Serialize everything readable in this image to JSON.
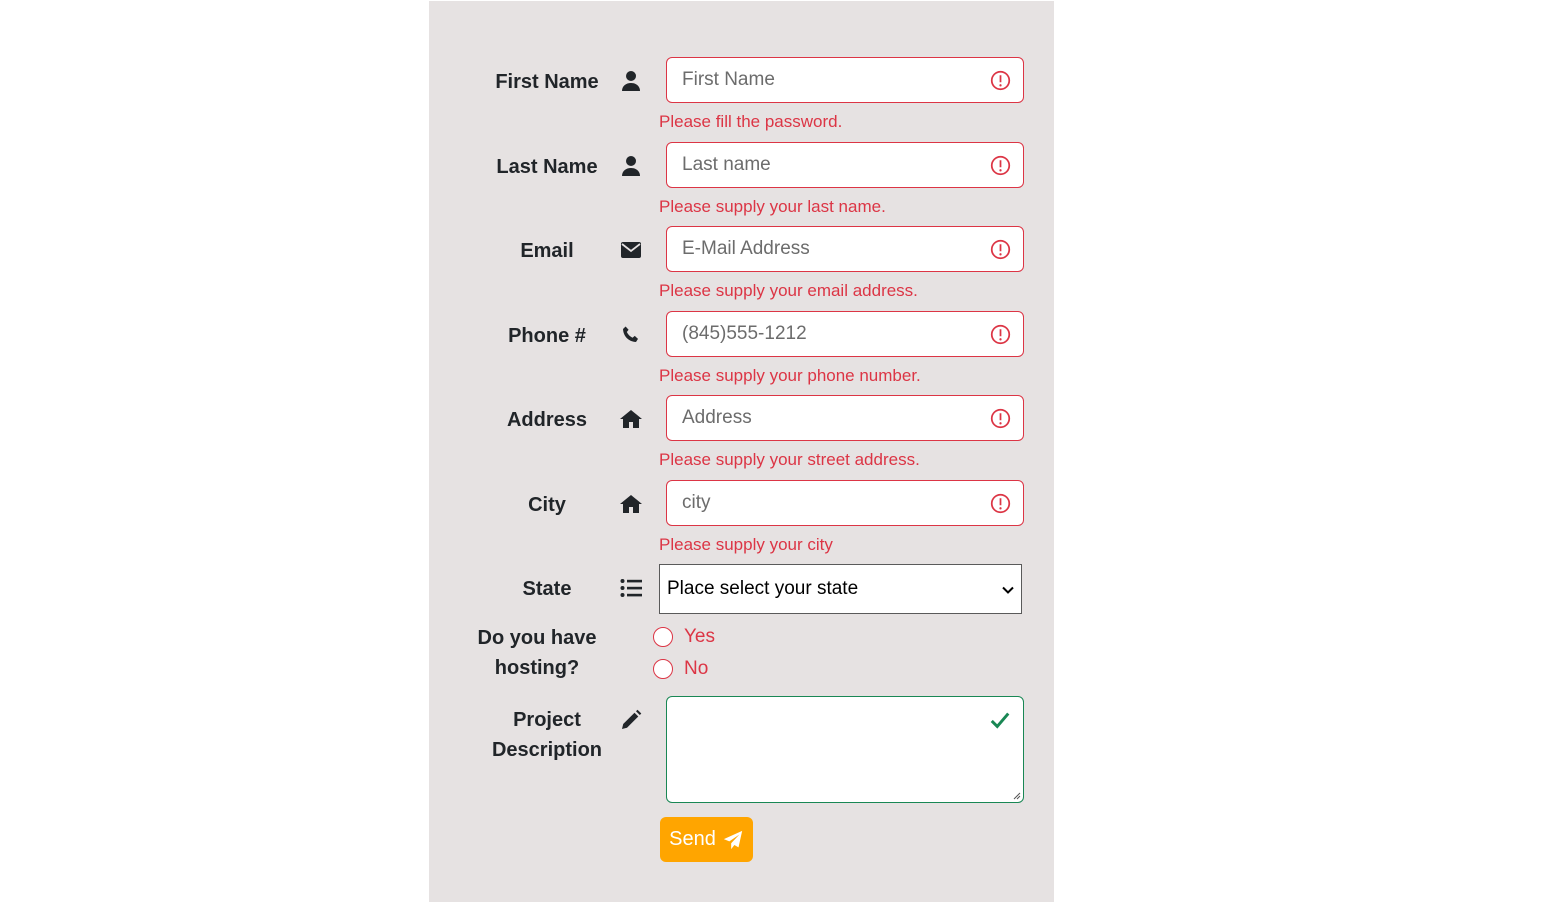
{
  "form": {
    "fields": [
      {
        "label": "First Name",
        "placeholder": "First Name",
        "icon": "user-icon",
        "error": "Please fill the password."
      },
      {
        "label": "Last Name",
        "placeholder": "Last name",
        "icon": "user-icon",
        "error": "Please supply your last name."
      },
      {
        "label": "Email",
        "placeholder": "E-Mail Address",
        "icon": "envelope-icon",
        "error": "Please supply your email address."
      },
      {
        "label": "Phone #",
        "placeholder": "(845)555-1212",
        "icon": "phone-icon",
        "error": "Please supply your phone number."
      },
      {
        "label": "Address",
        "placeholder": "Address",
        "icon": "home-icon",
        "error": "Please supply your street address."
      },
      {
        "label": "City",
        "placeholder": "city",
        "icon": "home-icon",
        "error": "Please supply your city"
      }
    ],
    "state": {
      "label": "State",
      "icon": "list-icon",
      "selected": "Place select your state"
    },
    "hosting": {
      "label_line1": "Do you have",
      "label_line2": "hosting?",
      "options": [
        "Yes",
        "No"
      ]
    },
    "description": {
      "label_line1": "Project",
      "label_line2": "Description",
      "icon": "pencil-icon"
    },
    "send_label": "Send",
    "colors": {
      "panel_bg": "#e6e2e2",
      "invalid": "#dc3545",
      "valid": "#198754",
      "send_button": "#ffa500"
    }
  }
}
